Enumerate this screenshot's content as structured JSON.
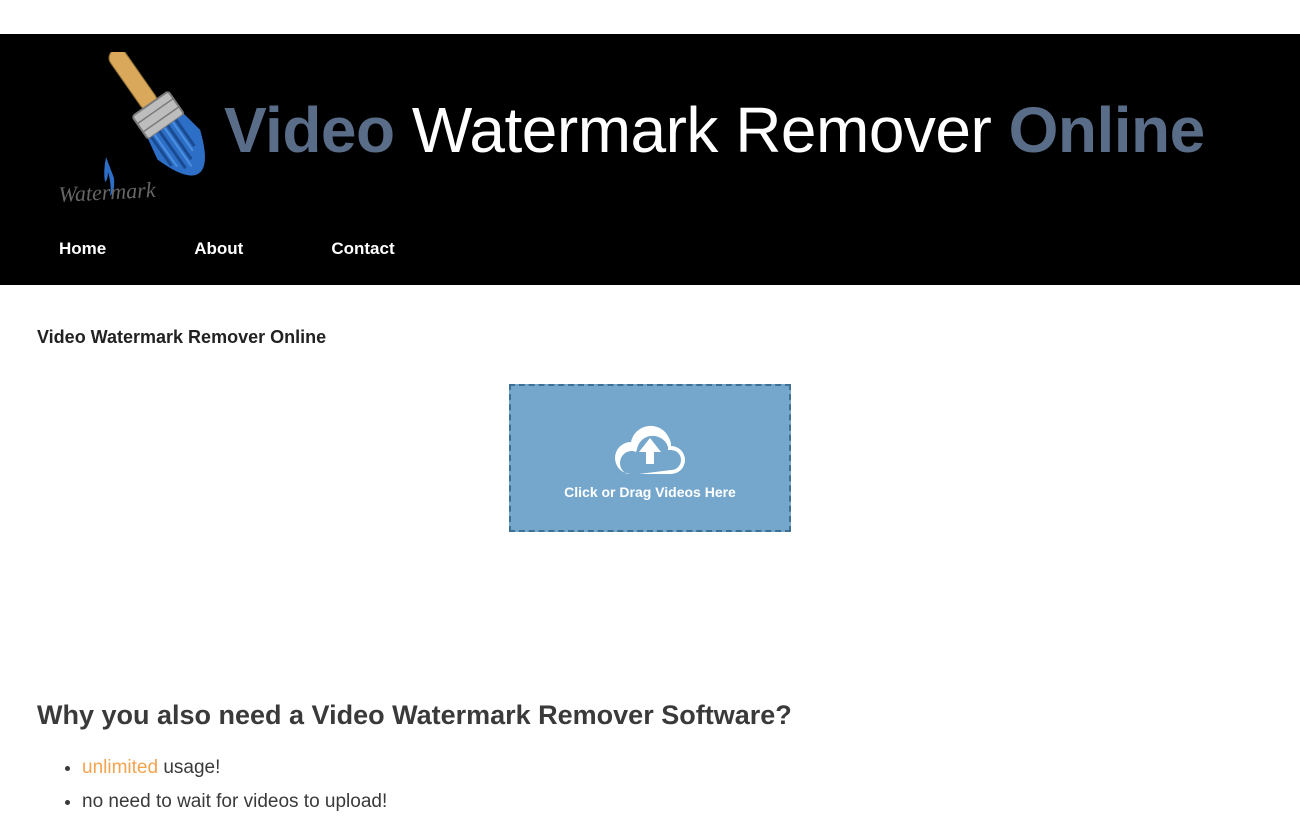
{
  "header": {
    "title_video": "Video",
    "title_middle": " Watermark Remover ",
    "title_online": "Online"
  },
  "nav": {
    "home": "Home",
    "about": "About",
    "contact": "Contact"
  },
  "page": {
    "title": "Video Watermark Remover Online"
  },
  "dropzone": {
    "label": "Click or Drag Videos Here"
  },
  "why": {
    "heading": "Why you also need a Video Watermark Remover Software?",
    "bullet1_highlight": "unlimited",
    "bullet1_rest": " usage!",
    "bullet2": "no need to wait for videos to upload!"
  }
}
